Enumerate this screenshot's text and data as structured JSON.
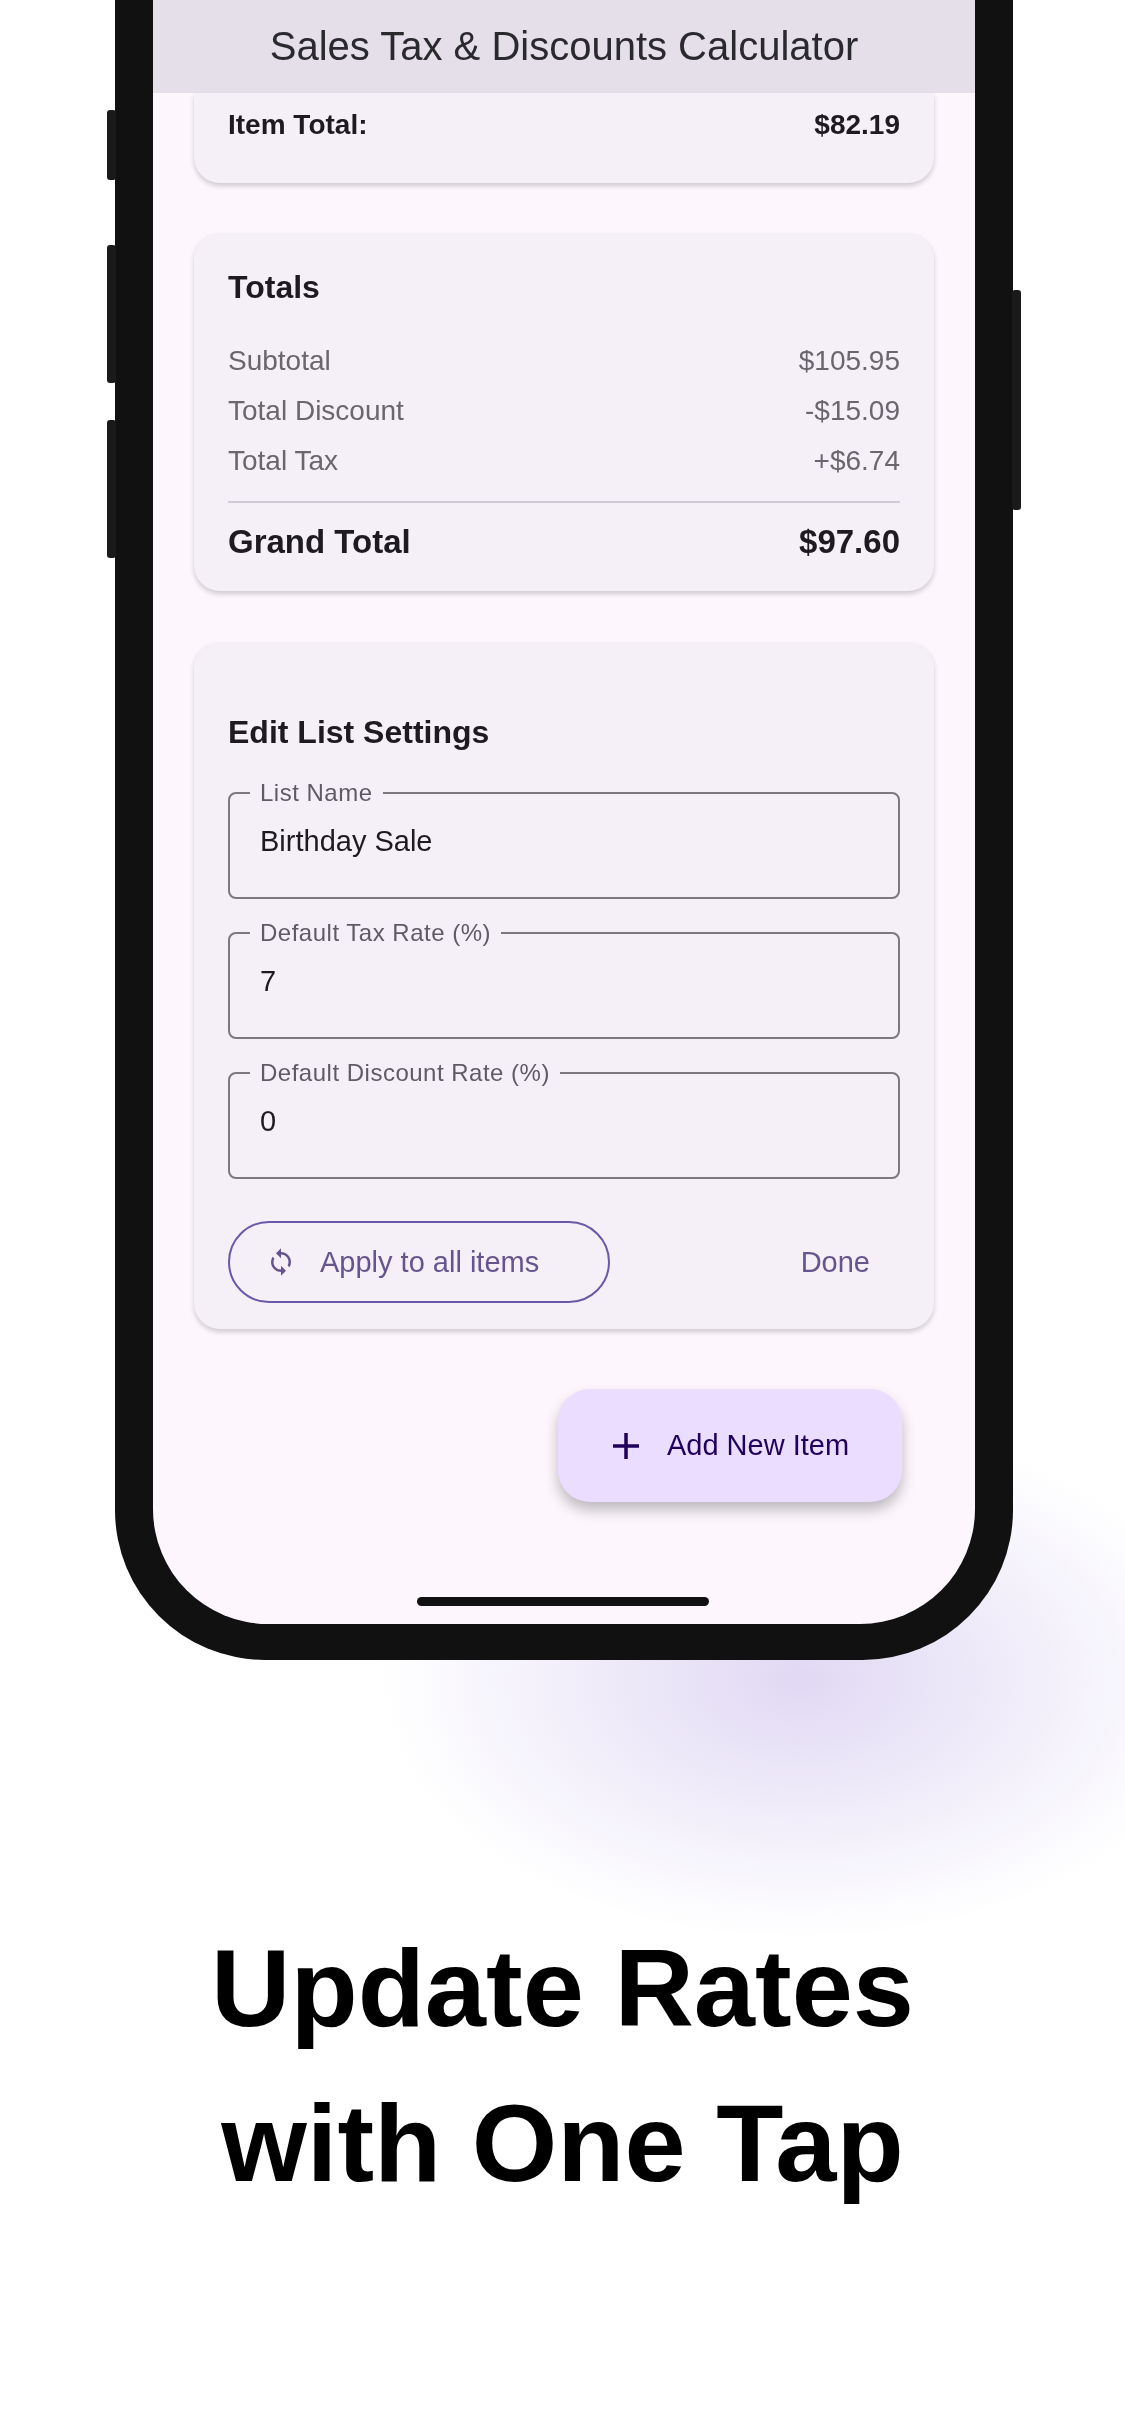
{
  "app_bar": {
    "title": "Sales Tax & Discounts Calculator"
  },
  "item_card": {
    "label": "Item Total:",
    "value": "$82.19"
  },
  "totals": {
    "title": "Totals",
    "rows": [
      {
        "label": "Subtotal",
        "value": "$105.95"
      },
      {
        "label": "Total Discount",
        "value": "-$15.09"
      },
      {
        "label": "Total Tax",
        "value": "+$6.74"
      }
    ],
    "grand_total": {
      "label": "Grand Total",
      "value": "$97.60"
    }
  },
  "settings": {
    "title": "Edit List Settings",
    "fields": [
      {
        "label": "List Name",
        "value": "Birthday Sale"
      },
      {
        "label": "Default Tax Rate (%)",
        "value": "7"
      },
      {
        "label": "Default Discount Rate (%)",
        "value": "0"
      }
    ],
    "apply_button": "Apply to all items",
    "done_button": "Done"
  },
  "fab": {
    "label": "Add New Item"
  },
  "headline": [
    "Update Rates",
    "with One Tap"
  ]
}
